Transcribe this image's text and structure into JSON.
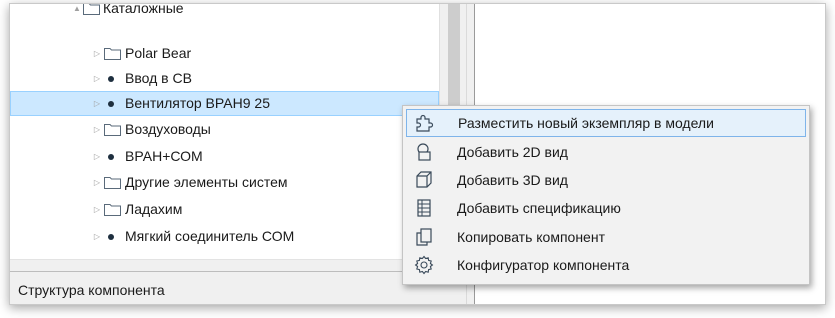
{
  "tree": {
    "items": [
      {
        "label": "Каталожные",
        "icon": "folder-icon",
        "expander": "▲",
        "expanded": true
      },
      {
        "label": "Polar Bear",
        "icon": "folder-icon",
        "expander": "▷"
      },
      {
        "label": "Ввод в СВ",
        "icon": "component-dot-icon",
        "expander": "▷"
      },
      {
        "label": "Вентилятор ВРАН9 25",
        "icon": "component-dot-icon",
        "expander": "▷",
        "selected": true
      },
      {
        "label": "Воздуховоды",
        "icon": "folder-icon",
        "expander": "▷"
      },
      {
        "label": "ВРАН+СОМ",
        "icon": "component-dot-icon",
        "expander": "▷"
      },
      {
        "label": "Другие элементы систем",
        "icon": "folder-icon",
        "expander": "▷"
      },
      {
        "label": "Ладахим",
        "icon": "folder-icon",
        "expander": "▷"
      },
      {
        "label": "Мягкий соединитель СОМ",
        "icon": "component-dot-icon",
        "expander": "▷"
      }
    ]
  },
  "status_bar": {
    "label": "Структура компонента"
  },
  "context_menu": {
    "items": [
      {
        "label": "Разместить новый экземпляр в модели",
        "icon": "puzzle-icon",
        "active": true
      },
      {
        "label": "Добавить 2D вид",
        "icon": "2d-view-icon"
      },
      {
        "label": "Добавить 3D вид",
        "icon": "3d-cube-icon"
      },
      {
        "label": "Добавить спецификацию",
        "icon": "specification-table-icon"
      },
      {
        "label": "Копировать компонент",
        "icon": "copy-icon"
      },
      {
        "label": "Конфигуратор компонента",
        "icon": "gear-icon"
      }
    ]
  },
  "colors": {
    "selection_fill": "#cce8ff",
    "selection_border": "#99d1ff",
    "menu_highlight_fill": "#e5f1fb",
    "menu_highlight_border": "#7eb4ea",
    "icon_stroke": "#3a4a5a",
    "folder_icon_stroke": "#5a6a7a"
  }
}
